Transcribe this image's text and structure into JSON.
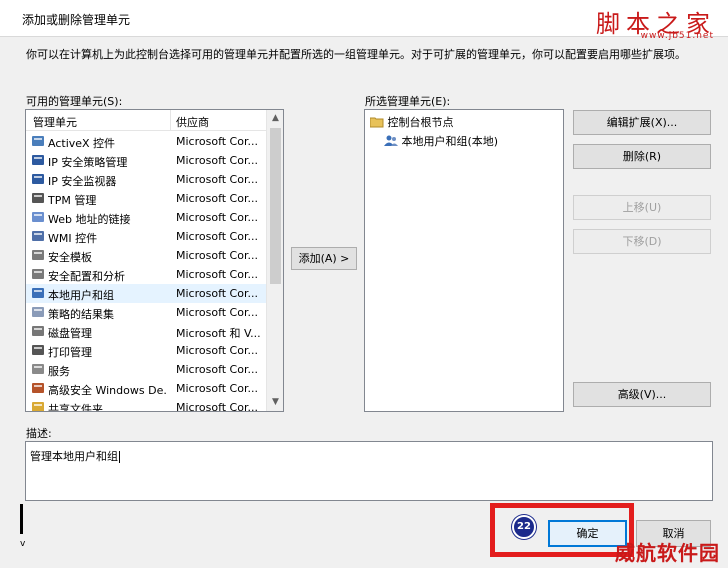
{
  "window": {
    "title": "添加或删除管理单元"
  },
  "watermark": {
    "logo": "脚本之家",
    "url": "www.jb51.net",
    "bottom": "威航软件园"
  },
  "intro": "你可以在计算机上为此控制台选择可用的管理单元并配置所选的一组管理单元。对于可扩展的管理单元，你可以配置要启用哪些扩展项。",
  "available": {
    "label": "可用的管理单元(S):",
    "col_name": "管理单元",
    "col_vendor": "供应商",
    "items": [
      {
        "name": "ActiveX 控件",
        "vendor": "Microsoft Cor...",
        "icon": "activex-icon"
      },
      {
        "name": "IP 安全策略管理",
        "vendor": "Microsoft Cor...",
        "icon": "ip-security-policy-icon"
      },
      {
        "name": "IP 安全监视器",
        "vendor": "Microsoft Cor...",
        "icon": "ip-security-monitor-icon"
      },
      {
        "name": "TPM 管理",
        "vendor": "Microsoft Cor...",
        "icon": "tpm-icon"
      },
      {
        "name": "Web 地址的链接",
        "vendor": "Microsoft Cor...",
        "icon": "web-link-icon"
      },
      {
        "name": "WMI 控件",
        "vendor": "Microsoft Cor...",
        "icon": "wmi-icon"
      },
      {
        "name": "安全模板",
        "vendor": "Microsoft Cor...",
        "icon": "security-template-icon"
      },
      {
        "name": "安全配置和分析",
        "vendor": "Microsoft Cor...",
        "icon": "security-config-icon"
      },
      {
        "name": "本地用户和组",
        "vendor": "Microsoft Cor...",
        "icon": "users-icon",
        "selected": true
      },
      {
        "name": "策略的结果集",
        "vendor": "Microsoft Cor...",
        "icon": "policy-result-icon"
      },
      {
        "name": "磁盘管理",
        "vendor": "Microsoft 和 V...",
        "icon": "disk-icon"
      },
      {
        "name": "打印管理",
        "vendor": "Microsoft Cor...",
        "icon": "printer-icon"
      },
      {
        "name": "服务",
        "vendor": "Microsoft Cor...",
        "icon": "services-icon"
      },
      {
        "name": "高级安全 Windows De...",
        "vendor": "Microsoft Cor...",
        "icon": "firewall-icon"
      },
      {
        "name": "共享文件夹",
        "vendor": "Microsoft Cor...",
        "icon": "shared-folder-icon"
      }
    ]
  },
  "add_button": "添加(A) >",
  "selected": {
    "label": "所选管理单元(E):",
    "root": "控制台根节点",
    "child": "本地用户和组(本地)"
  },
  "buttons": {
    "edit_ext": "编辑扩展(X)...",
    "remove": "删除(R)",
    "move_up": "上移(U)",
    "move_down": "下移(D)",
    "advanced": "高级(V)..."
  },
  "description": {
    "label": "描述:",
    "text": "管理本地用户和组"
  },
  "footer": {
    "ok": "确定",
    "cancel": "取消",
    "step_badge": "22"
  }
}
